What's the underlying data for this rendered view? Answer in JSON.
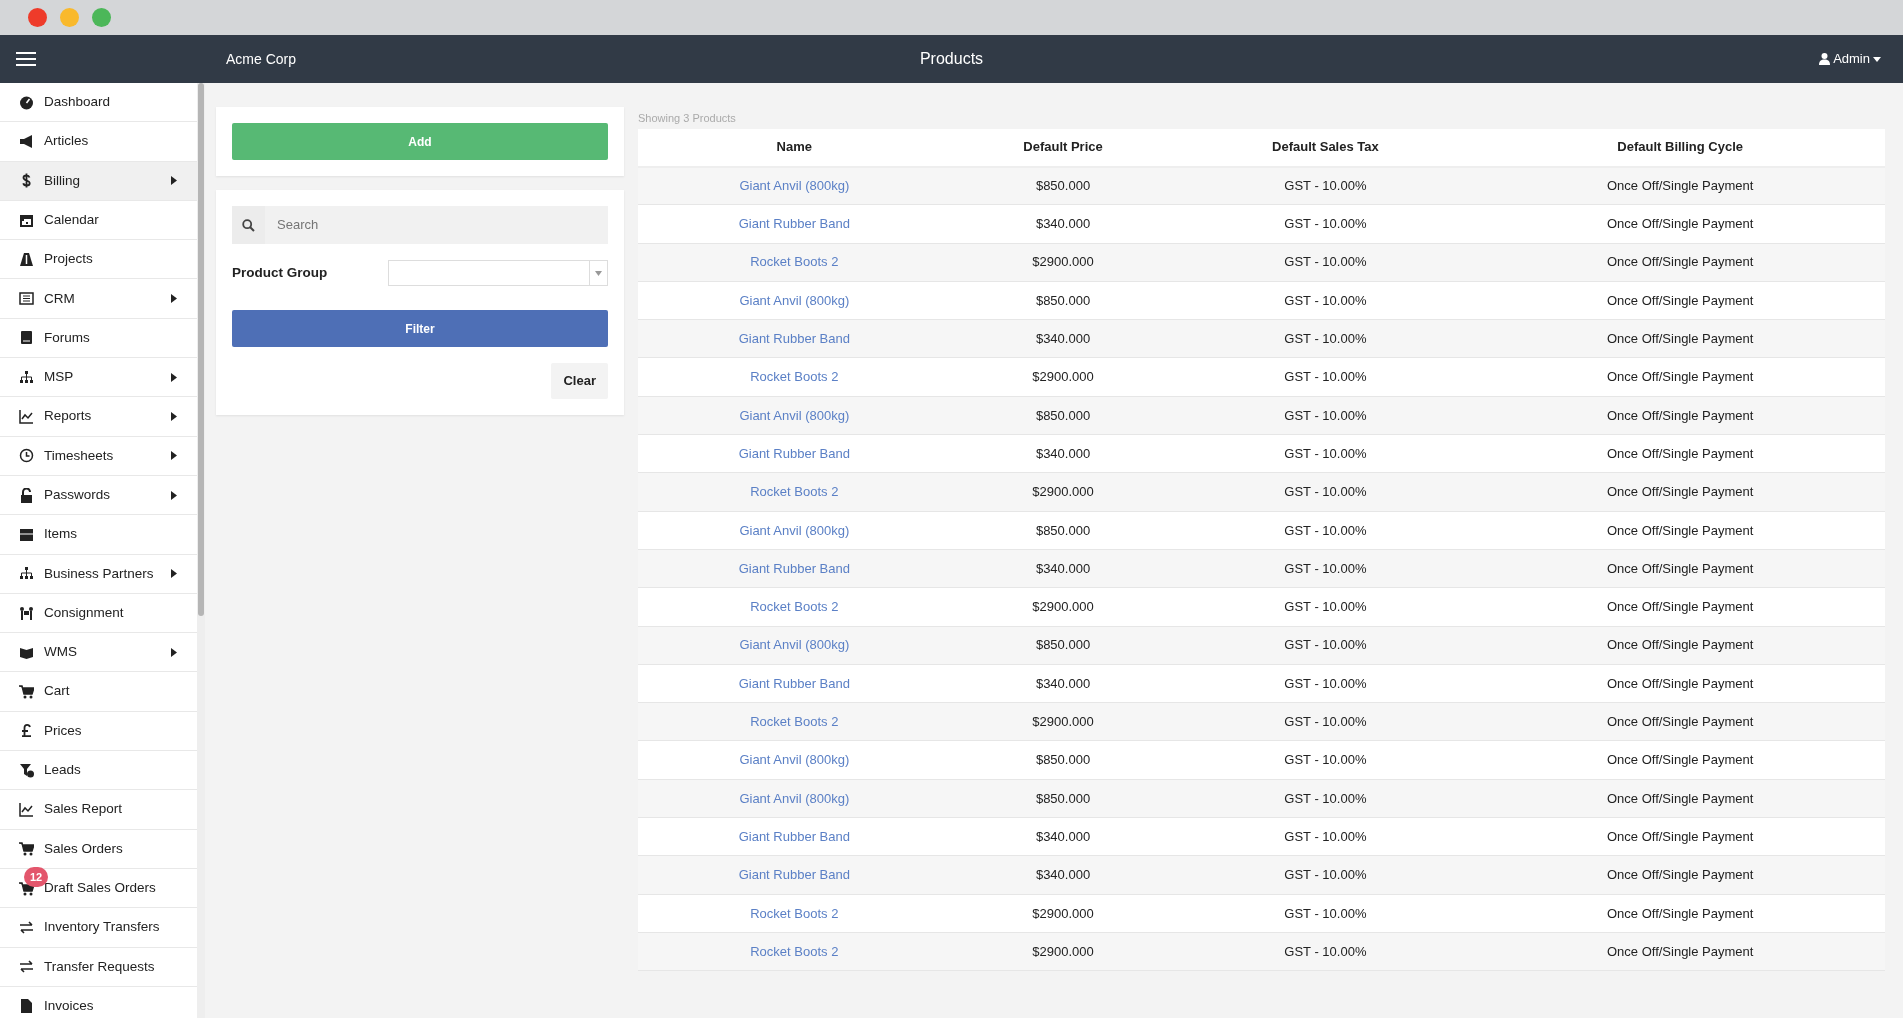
{
  "topbar": {
    "brand": "Acme Corp",
    "title": "Products",
    "user": "Admin"
  },
  "sidebar": {
    "items": [
      {
        "label": "Dashboard",
        "submenu": false,
        "selected": false
      },
      {
        "label": "Articles",
        "submenu": false,
        "selected": false
      },
      {
        "label": "Billing",
        "submenu": true,
        "selected": true
      },
      {
        "label": "Calendar",
        "submenu": false,
        "selected": false
      },
      {
        "label": "Projects",
        "submenu": false,
        "selected": false
      },
      {
        "label": "CRM",
        "submenu": true,
        "selected": false
      },
      {
        "label": "Forums",
        "submenu": false,
        "selected": false
      },
      {
        "label": "MSP",
        "submenu": true,
        "selected": false
      },
      {
        "label": "Reports",
        "submenu": true,
        "selected": false
      },
      {
        "label": "Timesheets",
        "submenu": true,
        "selected": false
      },
      {
        "label": "Passwords",
        "submenu": true,
        "selected": false
      },
      {
        "label": "Items",
        "submenu": false,
        "selected": false
      },
      {
        "label": "Business Partners",
        "submenu": true,
        "selected": false
      },
      {
        "label": "Consignment",
        "submenu": false,
        "selected": false
      },
      {
        "label": "WMS",
        "submenu": true,
        "selected": false
      },
      {
        "label": "Cart",
        "submenu": false,
        "selected": false
      },
      {
        "label": "Prices",
        "submenu": false,
        "selected": false
      },
      {
        "label": "Leads",
        "submenu": false,
        "selected": false
      },
      {
        "label": "Sales Report",
        "submenu": false,
        "selected": false
      },
      {
        "label": "Sales Orders",
        "submenu": false,
        "selected": false
      },
      {
        "label": "Draft Sales Orders",
        "submenu": false,
        "selected": false,
        "badge": "12"
      },
      {
        "label": "Inventory Transfers",
        "submenu": false,
        "selected": false
      },
      {
        "label": "Transfer Requests",
        "submenu": false,
        "selected": false
      },
      {
        "label": "Invoices",
        "submenu": false,
        "selected": false
      }
    ]
  },
  "actions": {
    "add_button": "Add"
  },
  "filters": {
    "search": {
      "placeholder": "Search"
    },
    "product_group": {
      "label": "Product Group"
    },
    "filter_button": "Filter",
    "clear_button": "Clear"
  },
  "table": {
    "caption": "Showing 3 Products",
    "columns": [
      "Name",
      "Default Price",
      "Default Sales Tax",
      "Default Billing Cycle"
    ],
    "rows": [
      [
        "Giant Anvil (800kg)",
        "$850.000",
        "GST - 10.00%",
        "Once Off/Single Payment"
      ],
      [
        "Giant Rubber Band",
        "$340.000",
        "GST - 10.00%",
        "Once Off/Single Payment"
      ],
      [
        "Rocket Boots 2",
        "$2900.000",
        "GST - 10.00%",
        "Once Off/Single Payment"
      ],
      [
        "Giant Anvil (800kg)",
        "$850.000",
        "GST - 10.00%",
        "Once Off/Single Payment"
      ],
      [
        "Giant Rubber Band",
        "$340.000",
        "GST - 10.00%",
        "Once Off/Single Payment"
      ],
      [
        "Rocket Boots 2",
        "$2900.000",
        "GST - 10.00%",
        "Once Off/Single Payment"
      ],
      [
        "Giant Anvil (800kg)",
        "$850.000",
        "GST - 10.00%",
        "Once Off/Single Payment"
      ],
      [
        "Giant Rubber Band",
        "$340.000",
        "GST - 10.00%",
        "Once Off/Single Payment"
      ],
      [
        "Rocket Boots 2",
        "$2900.000",
        "GST - 10.00%",
        "Once Off/Single Payment"
      ],
      [
        "Giant Anvil (800kg)",
        "$850.000",
        "GST - 10.00%",
        "Once Off/Single Payment"
      ],
      [
        "Giant Rubber Band",
        "$340.000",
        "GST - 10.00%",
        "Once Off/Single Payment"
      ],
      [
        "Rocket Boots 2",
        "$2900.000",
        "GST - 10.00%",
        "Once Off/Single Payment"
      ],
      [
        "Giant Anvil (800kg)",
        "$850.000",
        "GST - 10.00%",
        "Once Off/Single Payment"
      ],
      [
        "Giant Rubber Band",
        "$340.000",
        "GST - 10.00%",
        "Once Off/Single Payment"
      ],
      [
        "Rocket Boots 2",
        "$2900.000",
        "GST - 10.00%",
        "Once Off/Single Payment"
      ],
      [
        "Giant Anvil (800kg)",
        "$850.000",
        "GST - 10.00%",
        "Once Off/Single Payment"
      ],
      [
        "Giant Anvil (800kg)",
        "$850.000",
        "GST - 10.00%",
        "Once Off/Single Payment"
      ],
      [
        "Giant Rubber Band",
        "$340.000",
        "GST - 10.00%",
        "Once Off/Single Payment"
      ],
      [
        "Giant Rubber Band",
        "$340.000",
        "GST - 10.00%",
        "Once Off/Single Payment"
      ],
      [
        "Rocket Boots 2",
        "$2900.000",
        "GST - 10.00%",
        "Once Off/Single Payment"
      ],
      [
        "Rocket Boots 2",
        "$2900.000",
        "GST - 10.00%",
        "Once Off/Single Payment"
      ]
    ]
  }
}
